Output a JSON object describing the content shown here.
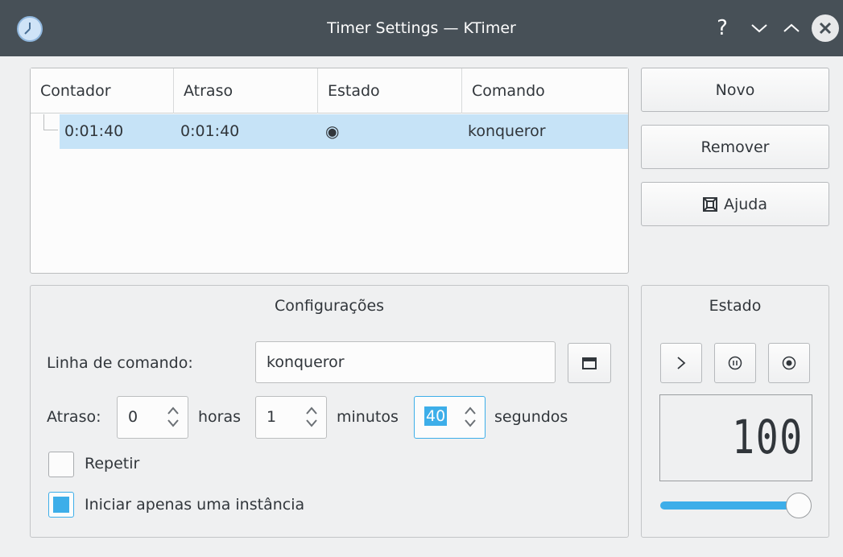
{
  "window": {
    "title": "Timer Settings — KTimer"
  },
  "titlebar": {
    "help": "?",
    "minimize": "⌄",
    "maximize": "⌃",
    "close": "✕"
  },
  "table": {
    "columns": [
      "Contador",
      "Atraso",
      "Estado",
      "Comando"
    ],
    "rows": [
      {
        "counter": "0:01:40",
        "delay": "0:01:40",
        "state": "◉",
        "command": "konqueror"
      }
    ]
  },
  "buttons": {
    "new": "Novo",
    "remove": "Remover",
    "help": "Ajuda"
  },
  "settings": {
    "title": "Configurações",
    "command_label": "Linha de comando:",
    "command_value": "konqueror",
    "delay_label": "Atraso:",
    "hours_value": "0",
    "hours_label": "horas",
    "minutes_value": "1",
    "minutes_label": "minutos",
    "seconds_value": "40",
    "seconds_label": "segundos",
    "repeat_label": "Repetir",
    "repeat_checked": false,
    "single_instance_label": "Iniciar apenas uma instância",
    "single_instance_checked": true
  },
  "state": {
    "title": "Estado",
    "play": "❯",
    "pause": "⏸",
    "stop": "◉",
    "lcd_value": "100",
    "slider_value": 1.0
  },
  "colors": {
    "accent": "#3daee9",
    "selection": "#c6e3f7",
    "titlebar": "#475057"
  },
  "icons": {
    "app": "clock-icon",
    "folder": "folder-icon",
    "help": "lifebuoy-icon"
  }
}
